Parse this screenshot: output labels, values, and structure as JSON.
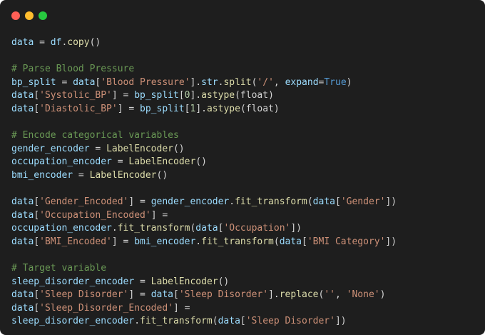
{
  "window": {
    "controls": {
      "close_color": "#ff5f56",
      "minimize_color": "#ffbd2e",
      "maximize_color": "#27c93f"
    }
  },
  "code_lines": [
    [
      [
        "var",
        "data"
      ],
      [
        "op",
        " = "
      ],
      [
        "var",
        "df"
      ],
      [
        "op",
        "."
      ],
      [
        "func",
        "copy"
      ],
      [
        "op",
        "()"
      ]
    ],
    [],
    [
      [
        "comment",
        "# Parse Blood Pressure"
      ]
    ],
    [
      [
        "var",
        "bp_split"
      ],
      [
        "op",
        " = "
      ],
      [
        "var",
        "data"
      ],
      [
        "op",
        "["
      ],
      [
        "string",
        "'Blood Pressure'"
      ],
      [
        "op",
        "]."
      ],
      [
        "var",
        "str"
      ],
      [
        "op",
        "."
      ],
      [
        "func",
        "split"
      ],
      [
        "op",
        "("
      ],
      [
        "string",
        "'/'"
      ],
      [
        "op",
        ", "
      ],
      [
        "param",
        "expand"
      ],
      [
        "op",
        "="
      ],
      [
        "kw",
        "True"
      ],
      [
        "op",
        ")"
      ]
    ],
    [
      [
        "var",
        "data"
      ],
      [
        "op",
        "["
      ],
      [
        "string",
        "'Systolic_BP'"
      ],
      [
        "op",
        "] = "
      ],
      [
        "var",
        "bp_split"
      ],
      [
        "op",
        "["
      ],
      [
        "number",
        "0"
      ],
      [
        "op",
        "]."
      ],
      [
        "func",
        "astype"
      ],
      [
        "op",
        "(float)"
      ]
    ],
    [
      [
        "var",
        "data"
      ],
      [
        "op",
        "["
      ],
      [
        "string",
        "'Diastolic_BP'"
      ],
      [
        "op",
        "] = "
      ],
      [
        "var",
        "bp_split"
      ],
      [
        "op",
        "["
      ],
      [
        "number",
        "1"
      ],
      [
        "op",
        "]."
      ],
      [
        "func",
        "astype"
      ],
      [
        "op",
        "(float)"
      ]
    ],
    [],
    [
      [
        "comment",
        "# Encode categorical variables"
      ]
    ],
    [
      [
        "var",
        "gender_encoder"
      ],
      [
        "op",
        " = "
      ],
      [
        "func",
        "LabelEncoder"
      ],
      [
        "op",
        "()"
      ]
    ],
    [
      [
        "var",
        "occupation_encoder"
      ],
      [
        "op",
        " = "
      ],
      [
        "func",
        "LabelEncoder"
      ],
      [
        "op",
        "()"
      ]
    ],
    [
      [
        "var",
        "bmi_encoder"
      ],
      [
        "op",
        " = "
      ],
      [
        "func",
        "LabelEncoder"
      ],
      [
        "op",
        "()"
      ]
    ],
    [],
    [
      [
        "var",
        "data"
      ],
      [
        "op",
        "["
      ],
      [
        "string",
        "'Gender_Encoded'"
      ],
      [
        "op",
        "] = "
      ],
      [
        "var",
        "gender_encoder"
      ],
      [
        "op",
        "."
      ],
      [
        "func",
        "fit_transform"
      ],
      [
        "op",
        "("
      ],
      [
        "var",
        "data"
      ],
      [
        "op",
        "["
      ],
      [
        "string",
        "'Gender'"
      ],
      [
        "op",
        "])"
      ]
    ],
    [
      [
        "var",
        "data"
      ],
      [
        "op",
        "["
      ],
      [
        "string",
        "'Occupation_Encoded'"
      ],
      [
        "op",
        "] ="
      ]
    ],
    [
      [
        "var",
        "occupation_encoder"
      ],
      [
        "op",
        "."
      ],
      [
        "func",
        "fit_transform"
      ],
      [
        "op",
        "("
      ],
      [
        "var",
        "data"
      ],
      [
        "op",
        "["
      ],
      [
        "string",
        "'Occupation'"
      ],
      [
        "op",
        "])"
      ]
    ],
    [
      [
        "var",
        "data"
      ],
      [
        "op",
        "["
      ],
      [
        "string",
        "'BMI_Encoded'"
      ],
      [
        "op",
        "] = "
      ],
      [
        "var",
        "bmi_encoder"
      ],
      [
        "op",
        "."
      ],
      [
        "func",
        "fit_transform"
      ],
      [
        "op",
        "("
      ],
      [
        "var",
        "data"
      ],
      [
        "op",
        "["
      ],
      [
        "string",
        "'BMI Category'"
      ],
      [
        "op",
        "])"
      ]
    ],
    [],
    [
      [
        "comment",
        "# Target variable"
      ]
    ],
    [
      [
        "var",
        "sleep_disorder_encoder"
      ],
      [
        "op",
        " = "
      ],
      [
        "func",
        "LabelEncoder"
      ],
      [
        "op",
        "()"
      ]
    ],
    [
      [
        "var",
        "data"
      ],
      [
        "op",
        "["
      ],
      [
        "string",
        "'Sleep Disorder'"
      ],
      [
        "op",
        "] = "
      ],
      [
        "var",
        "data"
      ],
      [
        "op",
        "["
      ],
      [
        "string",
        "'Sleep Disorder'"
      ],
      [
        "op",
        "]."
      ],
      [
        "func",
        "replace"
      ],
      [
        "op",
        "("
      ],
      [
        "string",
        "''"
      ],
      [
        "op",
        ", "
      ],
      [
        "string",
        "'None'"
      ],
      [
        "op",
        ")"
      ]
    ],
    [
      [
        "var",
        "data"
      ],
      [
        "op",
        "["
      ],
      [
        "string",
        "'Sleep_Disorder_Encoded'"
      ],
      [
        "op",
        "] ="
      ]
    ],
    [
      [
        "var",
        "sleep_disorder_encoder"
      ],
      [
        "op",
        "."
      ],
      [
        "func",
        "fit_transform"
      ],
      [
        "op",
        "("
      ],
      [
        "var",
        "data"
      ],
      [
        "op",
        "["
      ],
      [
        "string",
        "'Sleep Disorder'"
      ],
      [
        "op",
        "])"
      ]
    ]
  ]
}
